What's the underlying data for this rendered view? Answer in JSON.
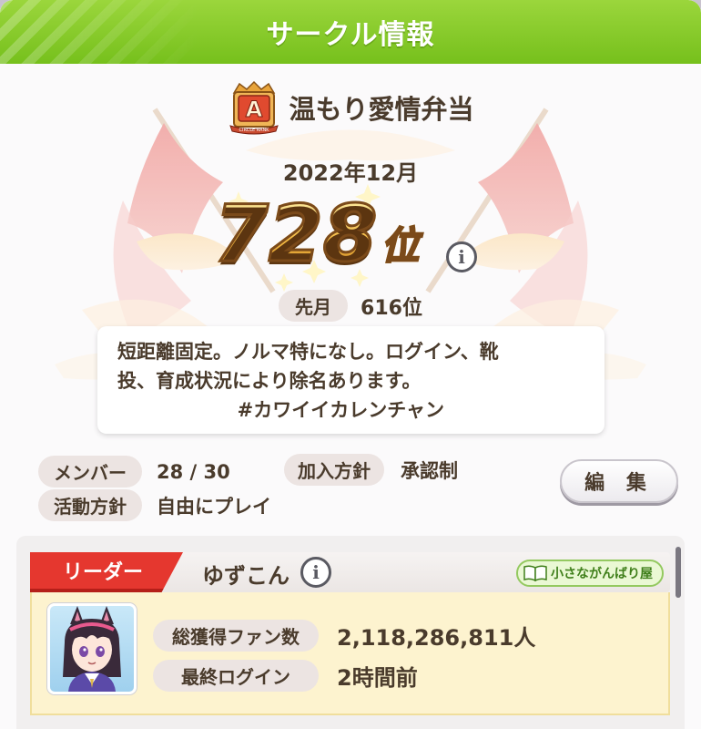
{
  "header": {
    "title": "サークル情報"
  },
  "circle": {
    "rank_badge": "A",
    "rank_badge_caption": "CIRCLE RANK",
    "name": "温もり愛情弁当"
  },
  "ranking": {
    "month": "2022年12月",
    "rank": "728",
    "rank_suffix": "位",
    "last_month_label": "先月",
    "last_month_value": "616位"
  },
  "description": "短距離固定。ノルマ特になし。ログイン、靴\n投、育成状況により除名あります。\n                  #カワイイカレンチャン",
  "stats": {
    "members_label": "メンバー",
    "members_value": "28 / 30",
    "join_policy_label": "加入方針",
    "join_policy_value": "承認制",
    "activity_label": "活動方針",
    "activity_value": "自由にプレイ"
  },
  "edit_button": "編 集",
  "leader": {
    "tag": "リーダー",
    "name": "ゆずこん",
    "title_badge": "小さながんばり屋",
    "fans_label": "総獲得ファン数",
    "fans_value": "2,118,286,811人",
    "last_login_label": "最終ログイン",
    "last_login_value": "2時間前"
  },
  "info_glyph": "i",
  "colors": {
    "header_green": "#8ccd2e",
    "leader_red": "#e5372f",
    "rank_gold": "#f3bb45",
    "text_brown": "#4a3b2c"
  }
}
